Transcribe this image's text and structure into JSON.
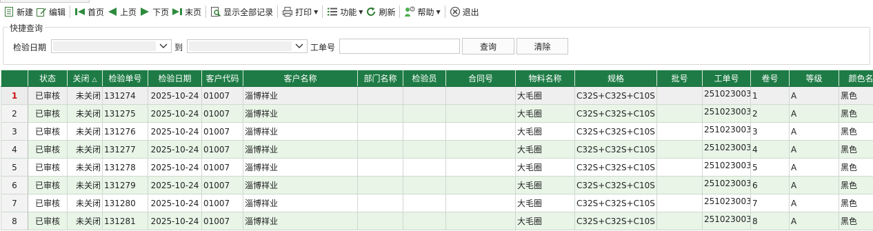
{
  "toolbar": {
    "items": [
      {
        "name": "new",
        "label": "新建"
      },
      {
        "name": "edit",
        "label": "编辑"
      },
      {
        "name": "first",
        "label": "首页"
      },
      {
        "name": "prev",
        "label": "上页"
      },
      {
        "name": "next",
        "label": "下页"
      },
      {
        "name": "last",
        "label": "末页"
      },
      {
        "name": "show_all",
        "label": "显示全部记录"
      },
      {
        "name": "print",
        "label": "打印"
      },
      {
        "name": "function",
        "label": "功能"
      },
      {
        "name": "refresh",
        "label": "刷新"
      },
      {
        "name": "help",
        "label": "帮助"
      },
      {
        "name": "exit",
        "label": "退出"
      }
    ]
  },
  "quick_search": {
    "title": "快捷查询",
    "date_label": "检验日期",
    "to_label": "到",
    "order_label": "工单号",
    "query_button": "查询",
    "clear_button": "清除"
  },
  "table": {
    "columns": [
      "状态",
      "关闭",
      "检验单号",
      "检验日期",
      "客户代码",
      "客户名称",
      "部门名称",
      "检验员",
      "合同号",
      "物料名称",
      "规格",
      "批号",
      "工单号",
      "卷号",
      "等级",
      "颜色名称"
    ],
    "sort_indicator": "△",
    "rows": [
      {
        "no": "1",
        "status": "已审核",
        "closed": "未关闭",
        "inspect_no": "131274",
        "date": "2025-10-24",
        "cust_code": "01007",
        "cust_name": "淄博祥业",
        "dept": "",
        "inspector": "",
        "contract": "",
        "material": "大毛圈",
        "spec": "C32S+C32S+C10S",
        "batch": "",
        "order_no": "251023003",
        "roll": "1",
        "grade": "A",
        "color": "黑色"
      },
      {
        "no": "2",
        "status": "已审核",
        "closed": "未关闭",
        "inspect_no": "131275",
        "date": "2025-10-24",
        "cust_code": "01007",
        "cust_name": "淄博祥业",
        "dept": "",
        "inspector": "",
        "contract": "",
        "material": "大毛圈",
        "spec": "C32S+C32S+C10S",
        "batch": "",
        "order_no": "251023003",
        "roll": "2",
        "grade": "A",
        "color": "黑色"
      },
      {
        "no": "3",
        "status": "已审核",
        "closed": "未关闭",
        "inspect_no": "131276",
        "date": "2025-10-24",
        "cust_code": "01007",
        "cust_name": "淄博祥业",
        "dept": "",
        "inspector": "",
        "contract": "",
        "material": "大毛圈",
        "spec": "C32S+C32S+C10S",
        "batch": "",
        "order_no": "251023003",
        "roll": "3",
        "grade": "A",
        "color": "黑色"
      },
      {
        "no": "4",
        "status": "已审核",
        "closed": "未关闭",
        "inspect_no": "131277",
        "date": "2025-10-24",
        "cust_code": "01007",
        "cust_name": "淄博祥业",
        "dept": "",
        "inspector": "",
        "contract": "",
        "material": "大毛圈",
        "spec": "C32S+C32S+C10S",
        "batch": "",
        "order_no": "251023003",
        "roll": "4",
        "grade": "A",
        "color": "黑色"
      },
      {
        "no": "5",
        "status": "已审核",
        "closed": "未关闭",
        "inspect_no": "131278",
        "date": "2025-10-24",
        "cust_code": "01007",
        "cust_name": "淄博祥业",
        "dept": "",
        "inspector": "",
        "contract": "",
        "material": "大毛圈",
        "spec": "C32S+C32S+C10S",
        "batch": "",
        "order_no": "251023003",
        "roll": "5",
        "grade": "A",
        "color": "黑色"
      },
      {
        "no": "6",
        "status": "已审核",
        "closed": "未关闭",
        "inspect_no": "131279",
        "date": "2025-10-24",
        "cust_code": "01007",
        "cust_name": "淄博祥业",
        "dept": "",
        "inspector": "",
        "contract": "",
        "material": "大毛圈",
        "spec": "C32S+C32S+C10S",
        "batch": "",
        "order_no": "251023003",
        "roll": "6",
        "grade": "A",
        "color": "黑色"
      },
      {
        "no": "7",
        "status": "已审核",
        "closed": "未关闭",
        "inspect_no": "131280",
        "date": "2025-10-24",
        "cust_code": "01007",
        "cust_name": "淄博祥业",
        "dept": "",
        "inspector": "",
        "contract": "",
        "material": "大毛圈",
        "spec": "C32S+C32S+C10S",
        "batch": "",
        "order_no": "251023003",
        "roll": "7",
        "grade": "A",
        "color": "黑色"
      },
      {
        "no": "8",
        "status": "已审核",
        "closed": "未关闭",
        "inspect_no": "131281",
        "date": "2025-10-24",
        "cust_code": "01007",
        "cust_name": "淄博祥业",
        "dept": "",
        "inspector": "",
        "contract": "",
        "material": "大毛圈",
        "spec": "C32S+C32S+C10S",
        "batch": "",
        "order_no": "251023003",
        "roll": "8",
        "grade": "A",
        "color": "黑色"
      }
    ]
  },
  "colors": {
    "header_bg": "#1e7b45",
    "row_alt": "#e8f5e7",
    "selected_row_number": "#d01010"
  }
}
